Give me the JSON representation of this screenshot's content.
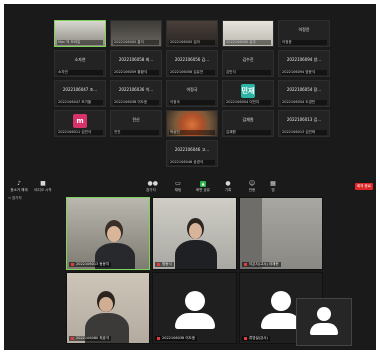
{
  "gallery": {
    "rows": [
      [
        {
          "name": "",
          "label": "Mac 의 모바일",
          "active": true,
          "video": "person"
        },
        {
          "name": "",
          "label": "2022106000 홍이",
          "video": "room"
        },
        {
          "name": "",
          "label": "2022106000 김아",
          "video": "person2"
        },
        {
          "name": "",
          "label": "2022106000 유우",
          "video": "person3"
        },
        {
          "name": "이정윤",
          "label": "이정윤"
        }
      ],
      [
        {
          "name": "소자연",
          "label": "소자연"
        },
        {
          "name": "2022106058 최...",
          "label": "2022106059 황황석"
        },
        {
          "name": "2022106056 김...",
          "label": "2022106056 김유찬"
        },
        {
          "name": "김수진",
          "label": "김민석"
        },
        {
          "name": "2022106094 양...",
          "label": "2022106094 양윤석"
        }
      ],
      [
        {
          "name": "2022106047 조...",
          "label": "2022106047 조가을"
        },
        {
          "name": "2022106036 이...",
          "label": "2022106036 이도윤"
        },
        {
          "name": "이정국",
          "label": "이정국"
        },
        {
          "name": "",
          "label": "2022106004 이민지",
          "avatar": "민재",
          "avatar_color": "#2bb3a3"
        },
        {
          "name": "2022106054 장...",
          "label": "2022106054 도경민"
        }
      ],
      [
        {
          "name": "",
          "label": "2022106011 김민석",
          "avatar": "m",
          "avatar_color": "#d6336c"
        },
        {
          "name": "전신",
          "label": "전진"
        },
        {
          "name": "",
          "label": "박상민",
          "video": "food"
        },
        {
          "name": "김채원",
          "label": "김채원"
        },
        {
          "name": "2022106013 김...",
          "label": "2022106013 김민혁"
        }
      ],
      [
        {
          "name": "2022106046 고...",
          "label": "2022106046 공경석"
        }
      ]
    ]
  },
  "toolbar": {
    "left": [
      {
        "icon": "microphone-icon",
        "glyph": "♪",
        "label": "음소거 해제"
      },
      {
        "icon": "video-icon",
        "glyph": "■",
        "label": "비디오 시작"
      }
    ],
    "center": [
      {
        "icon": "participants-icon",
        "glyph": "👥",
        "label": "참가자"
      },
      {
        "icon": "chat-icon",
        "glyph": "▭",
        "label": "채팅"
      },
      {
        "icon": "share-screen-icon",
        "glyph": "▲",
        "label": "화면 공유"
      },
      {
        "icon": "record-icon",
        "glyph": "●",
        "label": "기록"
      },
      {
        "icon": "reactions-icon",
        "glyph": "☺",
        "label": "반응"
      },
      {
        "icon": "apps-icon",
        "glyph": "▦",
        "label": "앱"
      }
    ],
    "end_label": "회의 종료",
    "side_label": "< 참가자"
  },
  "videos": [
    {
      "label": "2022106013 동윤지"
    },
    {
      "label": "정동식"
    },
    {
      "label": "이은지(고시) 아재현"
    },
    {
      "label": "2022106080 최효석"
    },
    {
      "label": "2022106036 이도윤"
    },
    {
      "label": "류영설(강사)"
    }
  ]
}
